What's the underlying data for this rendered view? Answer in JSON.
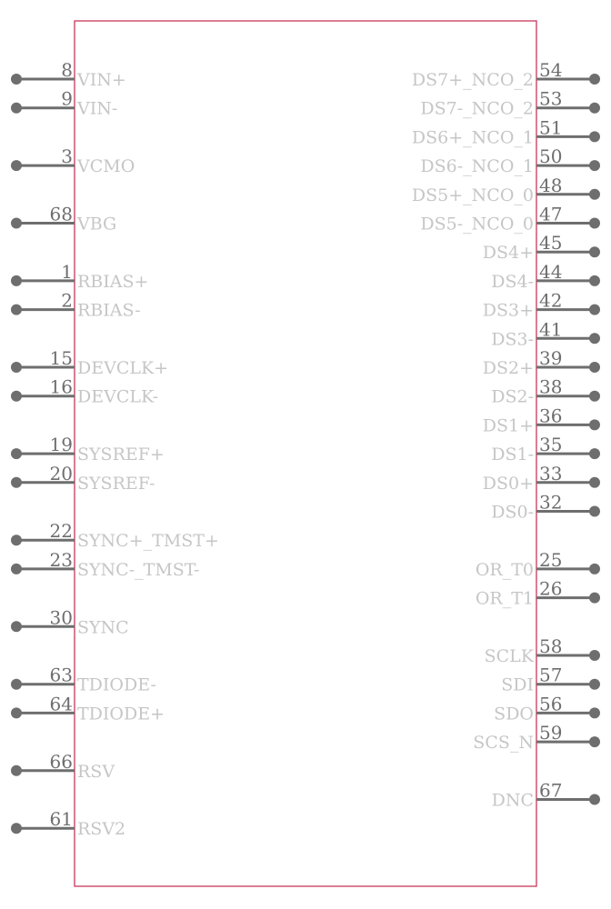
{
  "component": {
    "type": "schematic-symbol",
    "colors": {
      "outline": "#c8375a",
      "pin": "#6e6e6e",
      "pin_name": "#c6c6c6",
      "pin_number": "#6e6e6e"
    },
    "left_pins": [
      {
        "number": "8",
        "name": "VIN+",
        "row": 0
      },
      {
        "number": "9",
        "name": "VIN-",
        "row": 1
      },
      {
        "number": "3",
        "name": "VCMO",
        "row": 3
      },
      {
        "number": "68",
        "name": "VBG",
        "row": 5
      },
      {
        "number": "1",
        "name": "RBIAS+",
        "row": 7
      },
      {
        "number": "2",
        "name": "RBIAS-",
        "row": 8
      },
      {
        "number": "15",
        "name": "DEVCLK+",
        "row": 10
      },
      {
        "number": "16",
        "name": "DEVCLK-",
        "row": 11
      },
      {
        "number": "19",
        "name": "SYSREF+",
        "row": 13
      },
      {
        "number": "20",
        "name": "SYSREF-",
        "row": 14
      },
      {
        "number": "22",
        "name": "SYNC+_TMST+",
        "row": 16
      },
      {
        "number": "23",
        "name": "SYNC-_TMST-",
        "row": 17
      },
      {
        "number": "30",
        "name": "SYNC",
        "row": 19
      },
      {
        "number": "63",
        "name": "TDIODE-",
        "row": 21
      },
      {
        "number": "64",
        "name": "TDIODE+",
        "row": 22
      },
      {
        "number": "66",
        "name": "RSV",
        "row": 24
      },
      {
        "number": "61",
        "name": "RSV2",
        "row": 26
      }
    ],
    "right_pins": [
      {
        "number": "54",
        "name": "DS7+_NCO_2",
        "row": 0
      },
      {
        "number": "53",
        "name": "DS7-_NCO_2",
        "row": 1
      },
      {
        "number": "51",
        "name": "DS6+_NCO_1",
        "row": 2
      },
      {
        "number": "50",
        "name": "DS6-_NCO_1",
        "row": 3
      },
      {
        "number": "48",
        "name": "DS5+_NCO_0",
        "row": 4
      },
      {
        "number": "47",
        "name": "DS5-_NCO_0",
        "row": 5
      },
      {
        "number": "45",
        "name": "DS4+",
        "row": 6
      },
      {
        "number": "44",
        "name": "DS4-",
        "row": 7
      },
      {
        "number": "42",
        "name": "DS3+",
        "row": 8
      },
      {
        "number": "41",
        "name": "DS3-",
        "row": 9
      },
      {
        "number": "39",
        "name": "DS2+",
        "row": 10
      },
      {
        "number": "38",
        "name": "DS2-",
        "row": 11
      },
      {
        "number": "36",
        "name": "DS1+",
        "row": 12
      },
      {
        "number": "35",
        "name": "DS1-",
        "row": 13
      },
      {
        "number": "33",
        "name": "DS0+",
        "row": 14
      },
      {
        "number": "32",
        "name": "DS0-",
        "row": 15
      },
      {
        "number": "25",
        "name": "OR_T0",
        "row": 17
      },
      {
        "number": "26",
        "name": "OR_T1",
        "row": 18
      },
      {
        "number": "58",
        "name": "SCLK",
        "row": 20
      },
      {
        "number": "57",
        "name": "SDI",
        "row": 21
      },
      {
        "number": "56",
        "name": "SDO",
        "row": 22
      },
      {
        "number": "59",
        "name": "SCS_N",
        "row": 23
      },
      {
        "number": "67",
        "name": "DNC",
        "row": 25
      }
    ]
  }
}
